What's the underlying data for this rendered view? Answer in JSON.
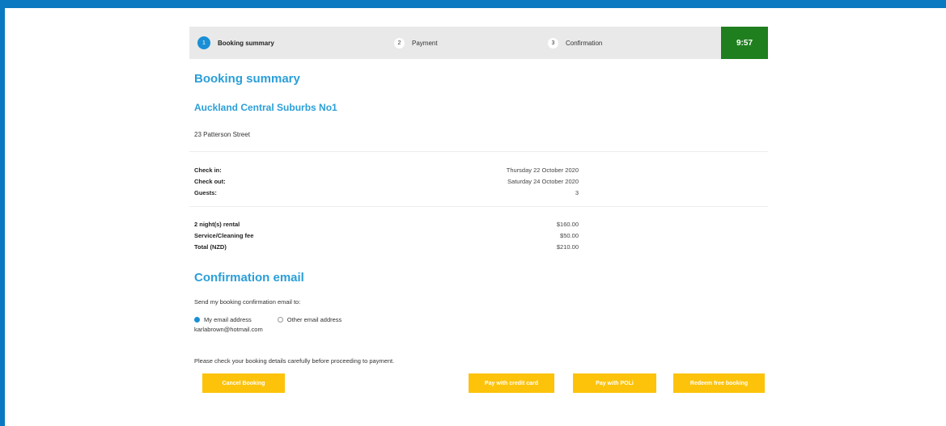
{
  "steps": [
    {
      "num": "1",
      "label": "Booking summary"
    },
    {
      "num": "2",
      "label": "Payment"
    },
    {
      "num": "3",
      "label": "Confirmation"
    }
  ],
  "timer": "9:57",
  "summary": {
    "title": "Booking summary",
    "property": "Auckland Central Suburbs No1",
    "address": "23 Patterson Street",
    "details": [
      {
        "label": "Check in:",
        "value": "Thursday 22 October 2020"
      },
      {
        "label": "Check out:",
        "value": "Saturday 24 October 2020"
      },
      {
        "label": "Guests:",
        "value": "3"
      }
    ],
    "prices": [
      {
        "label": "2 night(s) rental",
        "value": "$160.00"
      },
      {
        "label": "Service/Cleaning fee",
        "value": "$50.00"
      },
      {
        "label": "Total (NZD)",
        "value": "$210.00"
      }
    ]
  },
  "confirmation": {
    "title": "Confirmation email",
    "send_label": "Send my booking confirmation email to:",
    "options": [
      "My email address",
      "Other email address"
    ],
    "selected": "My email address",
    "email": "karlabrown@hotmail.com",
    "notice": "Please check your booking details carefully before proceeding to payment."
  },
  "buttons": {
    "cancel": "Cancel Booking",
    "credit": "Pay with credit card",
    "poli": "Pay with POLi",
    "redeem": "Redeem free booking"
  },
  "colors": {
    "accent": "#2a9fd8",
    "button": "#fcc30a",
    "timer": "#1f7f1f",
    "frame": "#0a79c2"
  }
}
